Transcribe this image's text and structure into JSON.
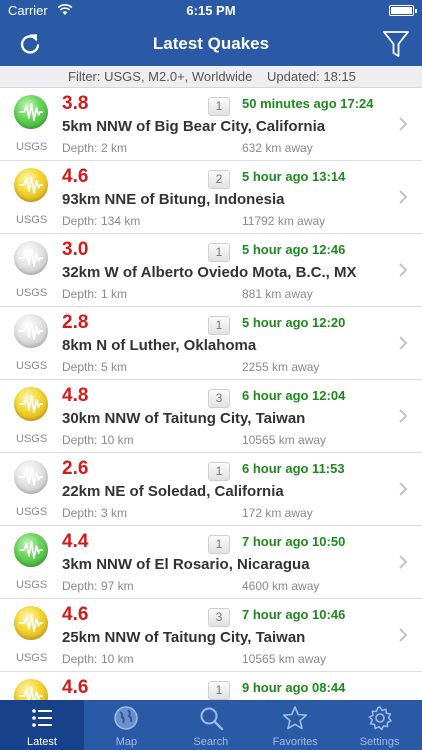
{
  "status": {
    "carrier": "Carrier",
    "time": "6:15 PM"
  },
  "nav": {
    "title": "Latest Quakes",
    "refresh_icon": "refresh-icon",
    "filter_icon": "filter-funnel-icon"
  },
  "filter_bar": {
    "filter_text": "Filter: USGS, M2.0+, Worldwide",
    "updated_text": "Updated: 18:15"
  },
  "quakes": [
    {
      "mag": "3.8",
      "count": "1",
      "when": "50 minutes ago 17:24",
      "place": "5km NNW of Big Bear City, California",
      "source": "USGS",
      "depth_label": "Depth:",
      "depth": "2 km",
      "distance": "632 km away",
      "color": "green"
    },
    {
      "mag": "4.6",
      "count": "2",
      "when": "5 hour ago 13:14",
      "place": "93km NNE of Bitung, Indonesia",
      "source": "USGS",
      "depth_label": "Depth:",
      "depth": "134 km",
      "distance": "11792 km away",
      "color": "yellow"
    },
    {
      "mag": "3.0",
      "count": "1",
      "when": "5 hour ago 12:46",
      "place": "32km W of Alberto Oviedo Mota, B.C., MX",
      "source": "USGS",
      "depth_label": "Depth:",
      "depth": "1 km",
      "distance": "881 km away",
      "color": "gray"
    },
    {
      "mag": "2.8",
      "count": "1",
      "when": "5 hour ago 12:20",
      "place": "8km N of Luther, Oklahoma",
      "source": "USGS",
      "depth_label": "Depth:",
      "depth": "5 km",
      "distance": "2255 km away",
      "color": "gray"
    },
    {
      "mag": "4.8",
      "count": "3",
      "when": "6 hour ago 12:04",
      "place": "30km NNW of Taitung City, Taiwan",
      "source": "USGS",
      "depth_label": "Depth:",
      "depth": "10 km",
      "distance": "10565 km away",
      "color": "yellow"
    },
    {
      "mag": "2.6",
      "count": "1",
      "when": "6 hour ago 11:53",
      "place": "22km NE of Soledad, California",
      "source": "USGS",
      "depth_label": "Depth:",
      "depth": "3 km",
      "distance": "172 km away",
      "color": "gray"
    },
    {
      "mag": "4.4",
      "count": "1",
      "when": "7 hour ago 10:50",
      "place": "3km NNW of El Rosario, Nicaragua",
      "source": "USGS",
      "depth_label": "Depth:",
      "depth": "97 km",
      "distance": "4600 km away",
      "color": "green"
    },
    {
      "mag": "4.6",
      "count": "3",
      "when": "7 hour ago 10:46",
      "place": "25km NNW of Taitung City, Taiwan",
      "source": "USGS",
      "depth_label": "Depth:",
      "depth": "10 km",
      "distance": "10565 km away",
      "color": "yellow"
    },
    {
      "mag": "4.6",
      "count": "1",
      "when": "9 hour ago 08:44",
      "place": "",
      "source": "",
      "depth_label": "",
      "depth": "",
      "distance": "",
      "color": "yellow"
    }
  ],
  "tabs": [
    {
      "label": "Latest",
      "icon": "list-icon",
      "active": true
    },
    {
      "label": "Map",
      "icon": "globe-icon",
      "active": false
    },
    {
      "label": "Search",
      "icon": "search-icon",
      "active": false
    },
    {
      "label": "Favorites",
      "icon": "star-icon",
      "active": false
    },
    {
      "label": "Settings",
      "icon": "gear-icon",
      "active": false
    }
  ]
}
